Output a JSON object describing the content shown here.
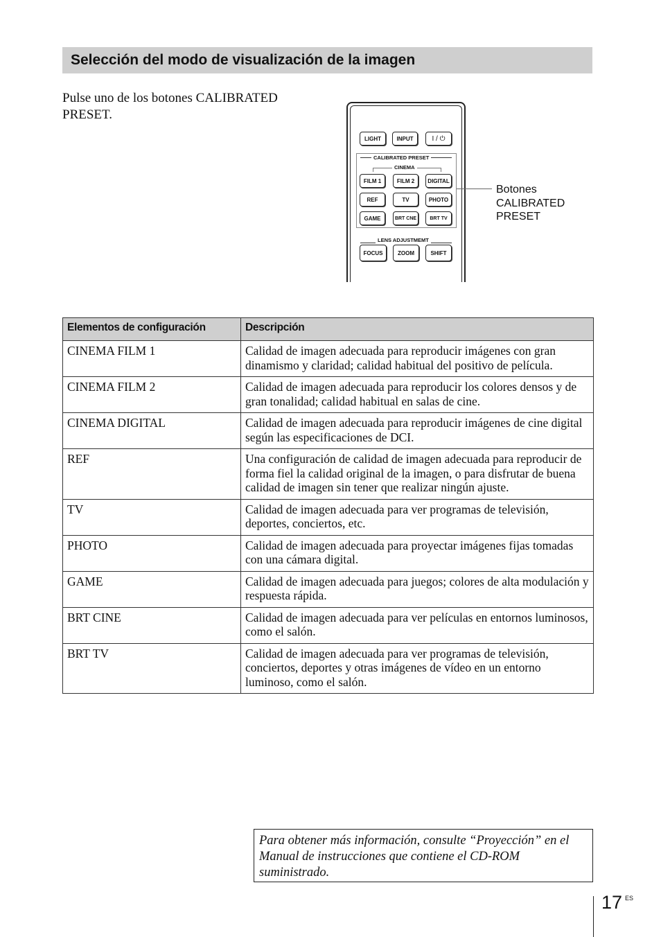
{
  "section": {
    "title": "Selección del modo de visualización de la imagen"
  },
  "instruction": "Pulse uno de los botones CALIBRATED PRESET.",
  "remote": {
    "top_buttons": [
      "LIGHT",
      "INPUT",
      "I / ⏻"
    ],
    "preset_group_label": "CALIBRATED PRESET",
    "cinema_label": "CINEMA",
    "preset_buttons": [
      [
        "FILM 1",
        "FILM 2",
        "DIGITAL"
      ],
      [
        "REF",
        "TV",
        "PHOTO"
      ],
      [
        "GAME",
        "BRT CNE",
        "BRT TV"
      ]
    ],
    "lens_label": "LENS ADJUSTMEMT",
    "lens_buttons": [
      "FOCUS",
      "ZOOM",
      "SHIFT"
    ],
    "callout": "Botones CALIBRATED PRESET"
  },
  "table": {
    "headers": [
      "Elementos de configuración",
      "Descripción"
    ],
    "rows": [
      {
        "item": "CINEMA FILM 1",
        "description": "Calidad de imagen adecuada para reproducir imágenes con gran dinamismo y claridad; calidad habitual del positivo de película."
      },
      {
        "item": "CINEMA FILM 2",
        "description": "Calidad de imagen adecuada para reproducir los colores densos y de gran tonalidad; calidad habitual en salas de cine."
      },
      {
        "item": "CINEMA DIGITAL",
        "description": "Calidad de imagen adecuada para reproducir imágenes de cine digital según las especificaciones de DCI."
      },
      {
        "item": "REF",
        "description": "Una configuración de calidad de imagen adecuada para reproducir de forma fiel la calidad original de la imagen, o para disfrutar de buena calidad de imagen sin tener que realizar ningún ajuste."
      },
      {
        "item": "TV",
        "description": "Calidad de imagen adecuada para ver programas de televisión, deportes, conciertos, etc."
      },
      {
        "item": "PHOTO",
        "description": "Calidad de imagen adecuada para proyectar imágenes fijas tomadas con una cámara digital."
      },
      {
        "item": "GAME",
        "description": "Calidad de imagen adecuada para juegos; colores de alta modulación y respuesta rápida."
      },
      {
        "item": "BRT CINE",
        "description": "Calidad de imagen adecuada para ver películas en entornos luminosos, como el salón."
      },
      {
        "item": "BRT TV",
        "description": "Calidad de imagen adecuada para ver programas de televisión, conciertos, deportes y otras imágenes de vídeo en un entorno luminoso, como el salón."
      }
    ]
  },
  "note": "Para obtener más información, consulte “Proyección” en el Manual de instrucciones que contiene el CD-ROM suministrado.",
  "footer": {
    "page_number": "17",
    "language": "ES"
  }
}
